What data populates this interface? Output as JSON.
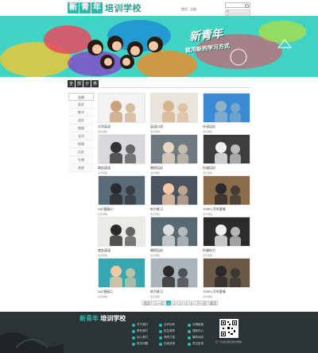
{
  "header": {
    "logo_chars": [
      "新",
      "青",
      "年"
    ],
    "logo_text": "培训学校",
    "top_links": [
      "首页",
      "注册"
    ],
    "top_buttons": [
      "▸",
      "▸"
    ]
  },
  "banner": {
    "title": "新青年",
    "subtitle": "就用新的学习方式"
  },
  "section": {
    "blocks": [
      "全",
      "部",
      "分",
      "类"
    ]
  },
  "sidebar": {
    "items": [
      {
        "label": "全部",
        "active": true
      },
      {
        "label": "英文"
      },
      {
        "label": "数学"
      },
      {
        "label": "语文"
      },
      {
        "label": "物理"
      },
      {
        "label": "化学"
      },
      {
        "label": "地理"
      },
      {
        "label": "历史"
      },
      {
        "label": "生物"
      },
      {
        "label": "其他"
      }
    ]
  },
  "courses": [
    {
      "name": "大学英语",
      "meta": "免费课程"
    },
    {
      "name": "英语口语",
      "meta": "免费课程"
    },
    {
      "name": "外语培训",
      "meta": "免费课程"
    },
    {
      "name": "商务英语",
      "meta": "免费课程"
    },
    {
      "name": "雅思培训",
      "meta": "免费课程"
    },
    {
      "name": "托福培训",
      "meta": "免费课程"
    },
    {
      "name": "SAT基础二",
      "meta": "免费课程"
    },
    {
      "name": "听力练习",
      "meta": "免费课程"
    },
    {
      "name": "TOEFL写作套餐",
      "meta": "免费课程"
    },
    {
      "name": "商务英语",
      "meta": "免费课程"
    },
    {
      "name": "雅思培训",
      "meta": "免费课程"
    },
    {
      "name": "托福听力",
      "meta": "免费课程"
    },
    {
      "name": "SAT基础二",
      "meta": "免费课程"
    },
    {
      "name": "听力练习",
      "meta": "免费课程"
    },
    {
      "name": "TOEFL写作套餐",
      "meta": "免费课程"
    }
  ],
  "pagination": {
    "first": "首页",
    "prev": "上一页",
    "pages": [
      "1",
      "2",
      "3",
      "4",
      "5"
    ],
    "next": "下一页",
    "last": "尾页"
  },
  "footer": {
    "logo_a": "新青年",
    "logo_b": "培训学校",
    "col1": [
      "关于我们",
      "联系我们",
      "加入我们",
      "常见问题"
    ],
    "col2": [
      "合作伙伴",
      "招生简章",
      "师资力量",
      "在线咨询"
    ],
    "col3": [
      "友情链接",
      "课程中心",
      "最新动态",
      "意见反馈"
    ],
    "qr_note": "扫一扫关注我们官方微信"
  },
  "colors": {
    "accent": "#2fb8a9",
    "banner": "#3fd4c4",
    "footer": "#2c3336"
  }
}
